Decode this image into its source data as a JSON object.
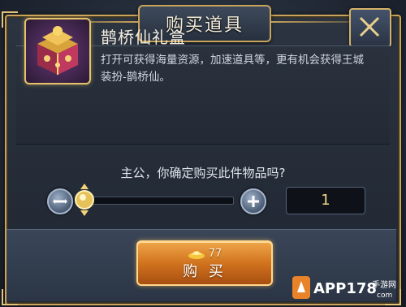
{
  "dialog": {
    "title": "购买道具"
  },
  "item": {
    "name": "鹊桥仙礼盒",
    "description": "打开可获得海量资源，加速道具等，更有机会获得王城装扮-鹊桥仙。",
    "icon": "gift-box-icon"
  },
  "confirm": {
    "prompt": "主公，你确定购买此件物品吗?"
  },
  "quantity": {
    "value": "1",
    "slider_fraction": 0
  },
  "buy_button": {
    "price": "77",
    "price_icon": "gold-ingot-icon",
    "label": "购 买"
  },
  "watermark": {
    "brand": "APP178",
    "sub": "手游网",
    "domain": "com"
  },
  "colors": {
    "gold": "#c9a45a",
    "button_orange": "#d1731e",
    "quantity_text": "#f0d78a"
  }
}
